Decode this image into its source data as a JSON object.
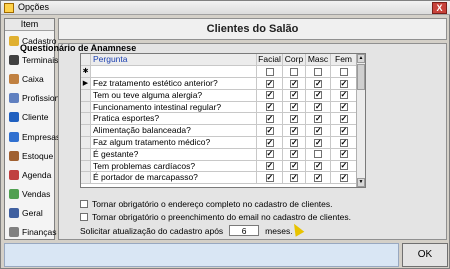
{
  "window": {
    "title": "Opções",
    "close_label": "X"
  },
  "sidebar": {
    "header": "Item",
    "items": [
      {
        "label": "Cadastro",
        "icon": "folder-icon",
        "color": "#e0b030"
      },
      {
        "label": "Terminais",
        "icon": "terminal-icon",
        "color": "#404040"
      },
      {
        "label": "Caixa",
        "icon": "cashbox-icon",
        "color": "#c08040"
      },
      {
        "label": "Profissional",
        "icon": "professional-icon",
        "color": "#6080c0"
      },
      {
        "label": "Cliente",
        "icon": "client-icon",
        "color": "#2060c0"
      },
      {
        "label": "Empresas",
        "icon": "info-icon",
        "color": "#3070d0"
      },
      {
        "label": "Estoque",
        "icon": "stock-icon",
        "color": "#a06030"
      },
      {
        "label": "Agenda",
        "icon": "calendar-icon",
        "color": "#c04040"
      },
      {
        "label": "Vendas",
        "icon": "sales-icon",
        "color": "#50a050"
      },
      {
        "label": "Geral",
        "icon": "general-icon",
        "color": "#4060a0"
      },
      {
        "label": "Finanças",
        "icon": "finance-icon",
        "color": "#808080"
      }
    ]
  },
  "main": {
    "banner": "Clientes do Salão",
    "section_title": "Questionário de Anamnese",
    "grid": {
      "headers": [
        "Pergunta",
        "Facial",
        "Corp",
        "Masc",
        "Fem"
      ],
      "new_row_marker": "✱",
      "current_row_marker": "▶",
      "rows": [
        {
          "q": "Fez tratamento estético anterior?",
          "v": [
            true,
            true,
            true,
            true
          ]
        },
        {
          "q": "Tem ou teve alguma alergia?",
          "v": [
            true,
            true,
            true,
            true
          ]
        },
        {
          "q": "Funcionamento intestinal regular?",
          "v": [
            true,
            true,
            true,
            true
          ]
        },
        {
          "q": "Pratica esportes?",
          "v": [
            true,
            true,
            true,
            true
          ]
        },
        {
          "q": "Alimentação balanceada?",
          "v": [
            true,
            true,
            true,
            true
          ]
        },
        {
          "q": "Faz algum tratamento médico?",
          "v": [
            true,
            true,
            true,
            true
          ]
        },
        {
          "q": "É gestante?",
          "v": [
            true,
            true,
            false,
            true
          ]
        },
        {
          "q": "Tem problemas cardíacos?",
          "v": [
            true,
            true,
            true,
            true
          ]
        },
        {
          "q": "É portador de marcapasso?",
          "v": [
            true,
            true,
            true,
            true
          ]
        }
      ]
    },
    "options": [
      {
        "label": "Tornar obrigatório o endereço completo no cadastro de clientes.",
        "checked": false
      },
      {
        "label": "Tornar obrigatório o preenchimento do email no cadastro de clientes.",
        "checked": false
      }
    ],
    "update_prefix": "Solicitar atualização do cadastro após",
    "update_value": "6",
    "update_suffix": "meses."
  },
  "footer": {
    "ok_label": "OK"
  }
}
